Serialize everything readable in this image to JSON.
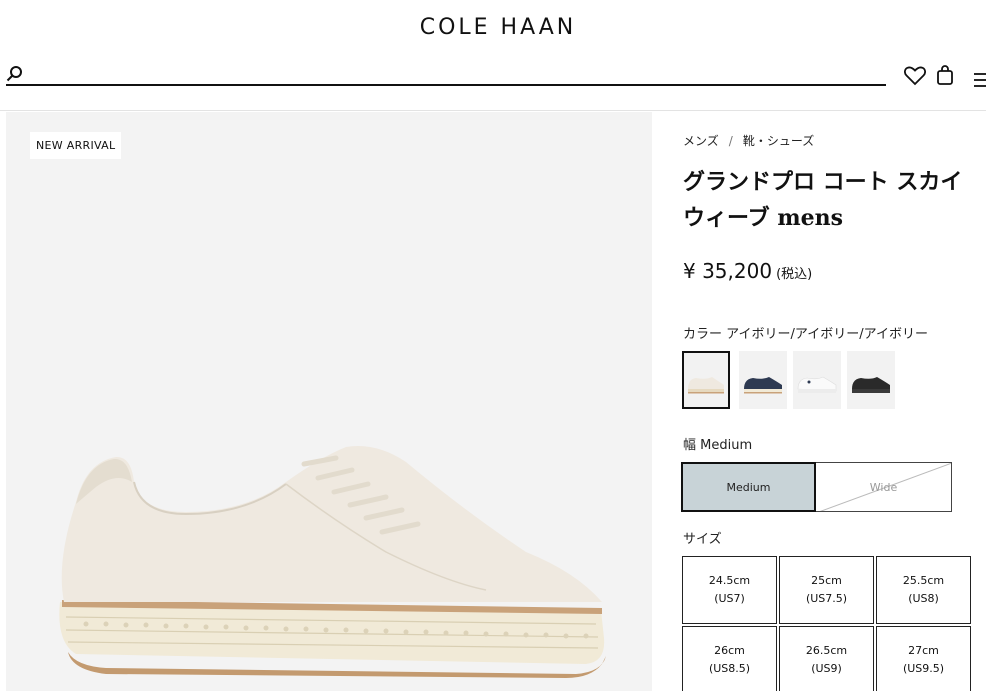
{
  "header": {
    "logo": "COLE HAAN",
    "search_placeholder": "",
    "icons": [
      "search-icon",
      "heart-icon",
      "bag-icon",
      "menu-icon"
    ]
  },
  "product": {
    "badge": "NEW ARRIVAL",
    "breadcrumb": [
      "メンズ",
      "靴・シューズ"
    ],
    "breadcrumb_separator": "/",
    "title_line1": "グランドプロ コート スカイ",
    "title_line2": "ウィーブ mens",
    "price": "¥ 35,200",
    "tax_note": "(税込)",
    "color_label": "カラー アイボリー/アイボリー/アイボリー",
    "swatches": [
      {
        "name": "ivory",
        "upper": "#efe9e0",
        "sole": "#c9a27a",
        "selected": true
      },
      {
        "name": "navy",
        "upper": "#2e3a52",
        "sole": "#c9a27a",
        "selected": false
      },
      {
        "name": "white",
        "upper": "#f7f7f7",
        "sole": "#e6e6e6",
        "selected": false
      },
      {
        "name": "black",
        "upper": "#2a2a2a",
        "sole": "#3a3a3a",
        "selected": false
      }
    ],
    "width_label": "幅 Medium",
    "width_options": [
      {
        "label": "Medium",
        "selected": true,
        "available": true
      },
      {
        "label": "Wide",
        "selected": false,
        "available": false
      }
    ],
    "size_label": "サイズ",
    "sizes": [
      {
        "cm": "24.5cm",
        "us": "(US7)"
      },
      {
        "cm": "25cm",
        "us": "(US7.5)"
      },
      {
        "cm": "25.5cm",
        "us": "(US8)"
      },
      {
        "cm": "26cm",
        "us": "(US8.5)"
      },
      {
        "cm": "26.5cm",
        "us": "(US9)"
      },
      {
        "cm": "27cm",
        "us": "(US9.5)"
      }
    ]
  },
  "colors": {
    "image_bg": "#f3f3f3",
    "selected_width_bg": "#c8d3d7",
    "shoe_upper": "#efe9e0",
    "shoe_sole_band": "#c9a27a"
  }
}
